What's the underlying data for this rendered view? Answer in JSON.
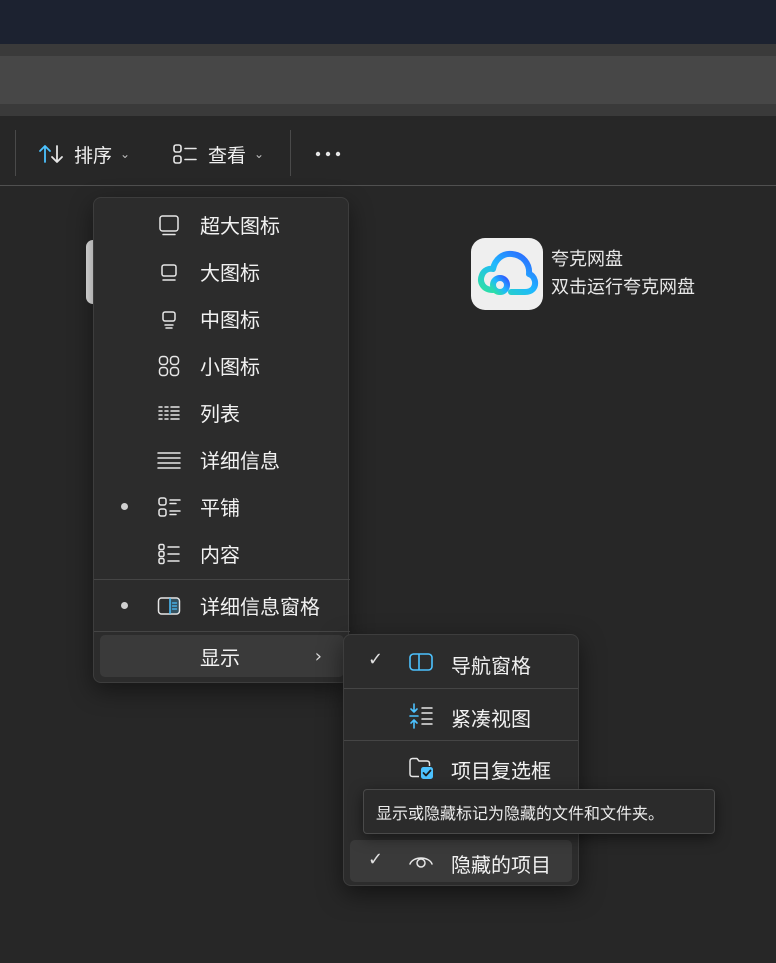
{
  "toolbar": {
    "sort_label": "排序",
    "view_label": "查看",
    "sort_icon": "sort-arrows-icon",
    "view_icon": "view-list-icon",
    "more_icon": "more-dots-icon"
  },
  "desktop_item": {
    "name": "夸克网盘",
    "subtitle": "双击运行夸克网盘",
    "icon": "quark-cloud-icon"
  },
  "view_menu": {
    "items": [
      {
        "label": "超大图标",
        "icon": "extra-large-icons-icon",
        "selected": false
      },
      {
        "label": "大图标",
        "icon": "large-icons-icon",
        "selected": false
      },
      {
        "label": "中图标",
        "icon": "medium-icons-icon",
        "selected": false
      },
      {
        "label": "小图标",
        "icon": "small-icons-icon",
        "selected": false
      },
      {
        "label": "列表",
        "icon": "list-icon",
        "selected": false
      },
      {
        "label": "详细信息",
        "icon": "details-icon",
        "selected": false
      },
      {
        "label": "平铺",
        "icon": "tiles-icon",
        "selected": true
      },
      {
        "label": "内容",
        "icon": "content-icon",
        "selected": false
      }
    ],
    "details_pane": {
      "label": "详细信息窗格",
      "icon": "details-pane-icon",
      "selected": true
    },
    "show": {
      "label": "显示",
      "arrow": "›"
    }
  },
  "show_submenu": {
    "items": [
      {
        "label": "导航窗格",
        "icon": "navigation-pane-icon",
        "checked": true
      },
      {
        "label": "紧凑视图",
        "icon": "compact-view-icon",
        "checked": false
      },
      {
        "label": "项目复选框",
        "icon": "item-checkboxes-icon",
        "checked": false
      },
      {
        "label": "隐藏的项目",
        "icon": "hidden-items-eye-icon",
        "checked": true
      }
    ],
    "check_mark": "✓"
  },
  "tooltip": {
    "text": "显示或隐藏标记为隐藏的文件和文件夹。"
  },
  "colors": {
    "accent": "#4cc2ff",
    "background": "#272727",
    "menu": "#2c2c2c"
  }
}
